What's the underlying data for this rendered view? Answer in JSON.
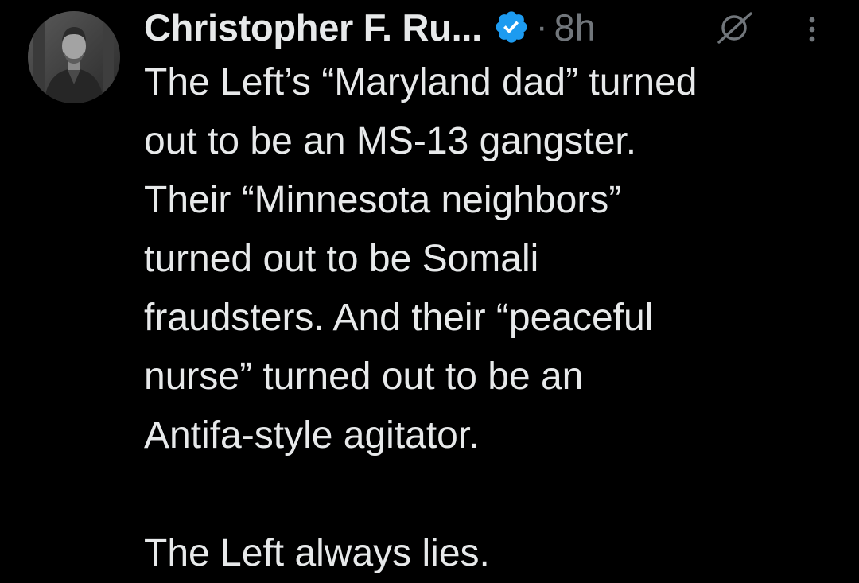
{
  "author": {
    "display_name": "Christopher F. Ru...",
    "verified_icon": "verified-badge-icon",
    "separator": "·",
    "timestamp": "8h"
  },
  "actions": {
    "grok_icon": "grok-icon",
    "more_icon": "more-vertical-icon"
  },
  "tweet": {
    "lines": [
      "The Left’s “Maryland dad” turned",
      "out to be an MS-13 gangster.",
      "Their “Minnesota neighbors”",
      "turned out to be Somali",
      "fraudsters. And their “peaceful",
      "nurse” turned out to be an",
      "Antifa-style agitator."
    ],
    "closing_line": "The Left always lies."
  },
  "colors": {
    "background": "#000000",
    "text_primary": "#e7e9ea",
    "text_secondary": "#71767b",
    "verified_blue": "#1d9bf0"
  }
}
